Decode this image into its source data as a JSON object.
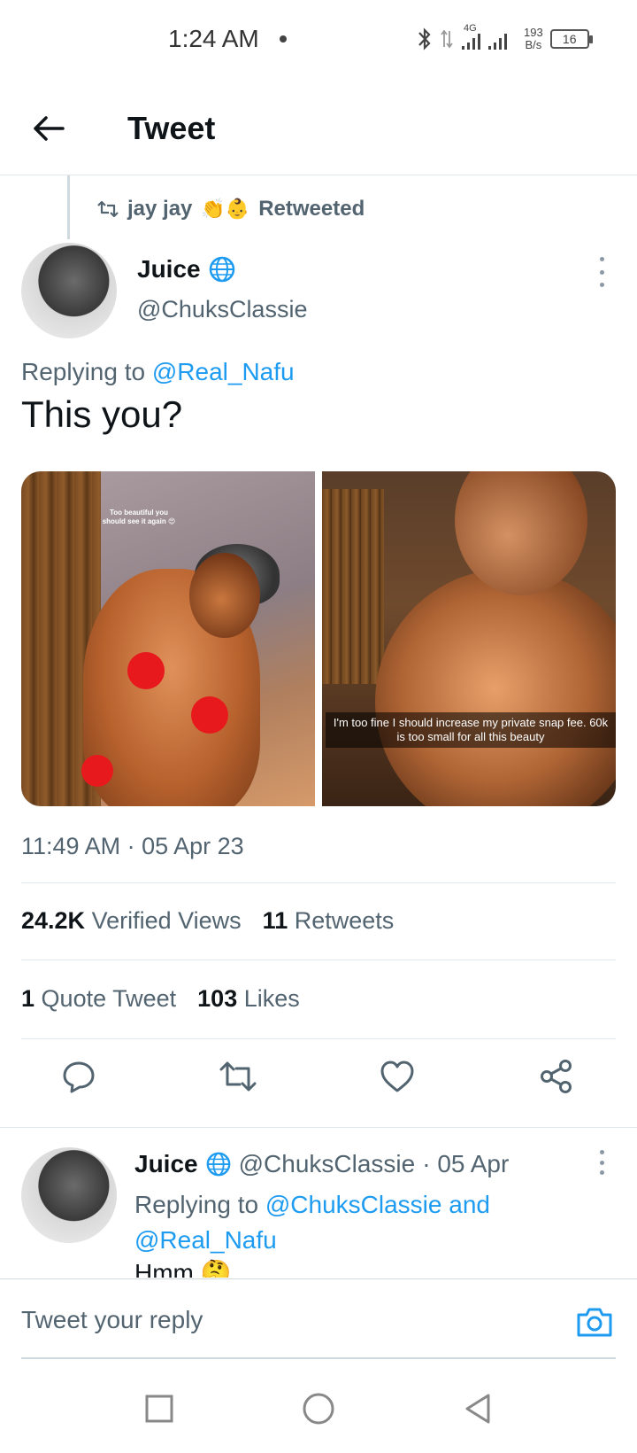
{
  "status_bar": {
    "time": "1:24 AM",
    "net_speed_value": "193",
    "net_speed_unit": "B/s",
    "network_type": "4G",
    "battery": "16"
  },
  "header": {
    "title": "Tweet"
  },
  "retweet": {
    "retweeter": "jay jay",
    "emoji": "👏👶",
    "label": "Retweeted"
  },
  "tweet": {
    "author_name": "Juice",
    "author_handle": "@ChuksClassie",
    "replying_prefix": "Replying to",
    "replying_to": "@Real_Nafu",
    "text": "This you?",
    "media": [
      {
        "caption": "Too beautiful you should see it again 😍"
      },
      {
        "caption": "I'm too fine I should increase my private snap fee. 60k is too small for all this beauty"
      }
    ],
    "timestamp": "11:49 AM · 05 Apr 23",
    "stats": {
      "views_count": "24.2K",
      "views_label": "Verified Views",
      "retweets_count": "11",
      "retweets_label": "Retweets",
      "quotes_count": "1",
      "quotes_label": "Quote Tweet",
      "likes_count": "103",
      "likes_label": "Likes"
    }
  },
  "reply": {
    "author_name": "Juice",
    "author_handle": "@ChuksClassie",
    "date": "· 05 Apr",
    "replying_prefix": "Replying to",
    "replying_to_1": "@ChuksClassie and",
    "replying_to_2": "@Real_Nafu",
    "text": "Hmm 🤔"
  },
  "composer": {
    "placeholder": "Tweet your reply"
  },
  "colors": {
    "accent": "#1d9bf0",
    "secondary_text": "#536471",
    "censor_dot": "#e8191c"
  }
}
